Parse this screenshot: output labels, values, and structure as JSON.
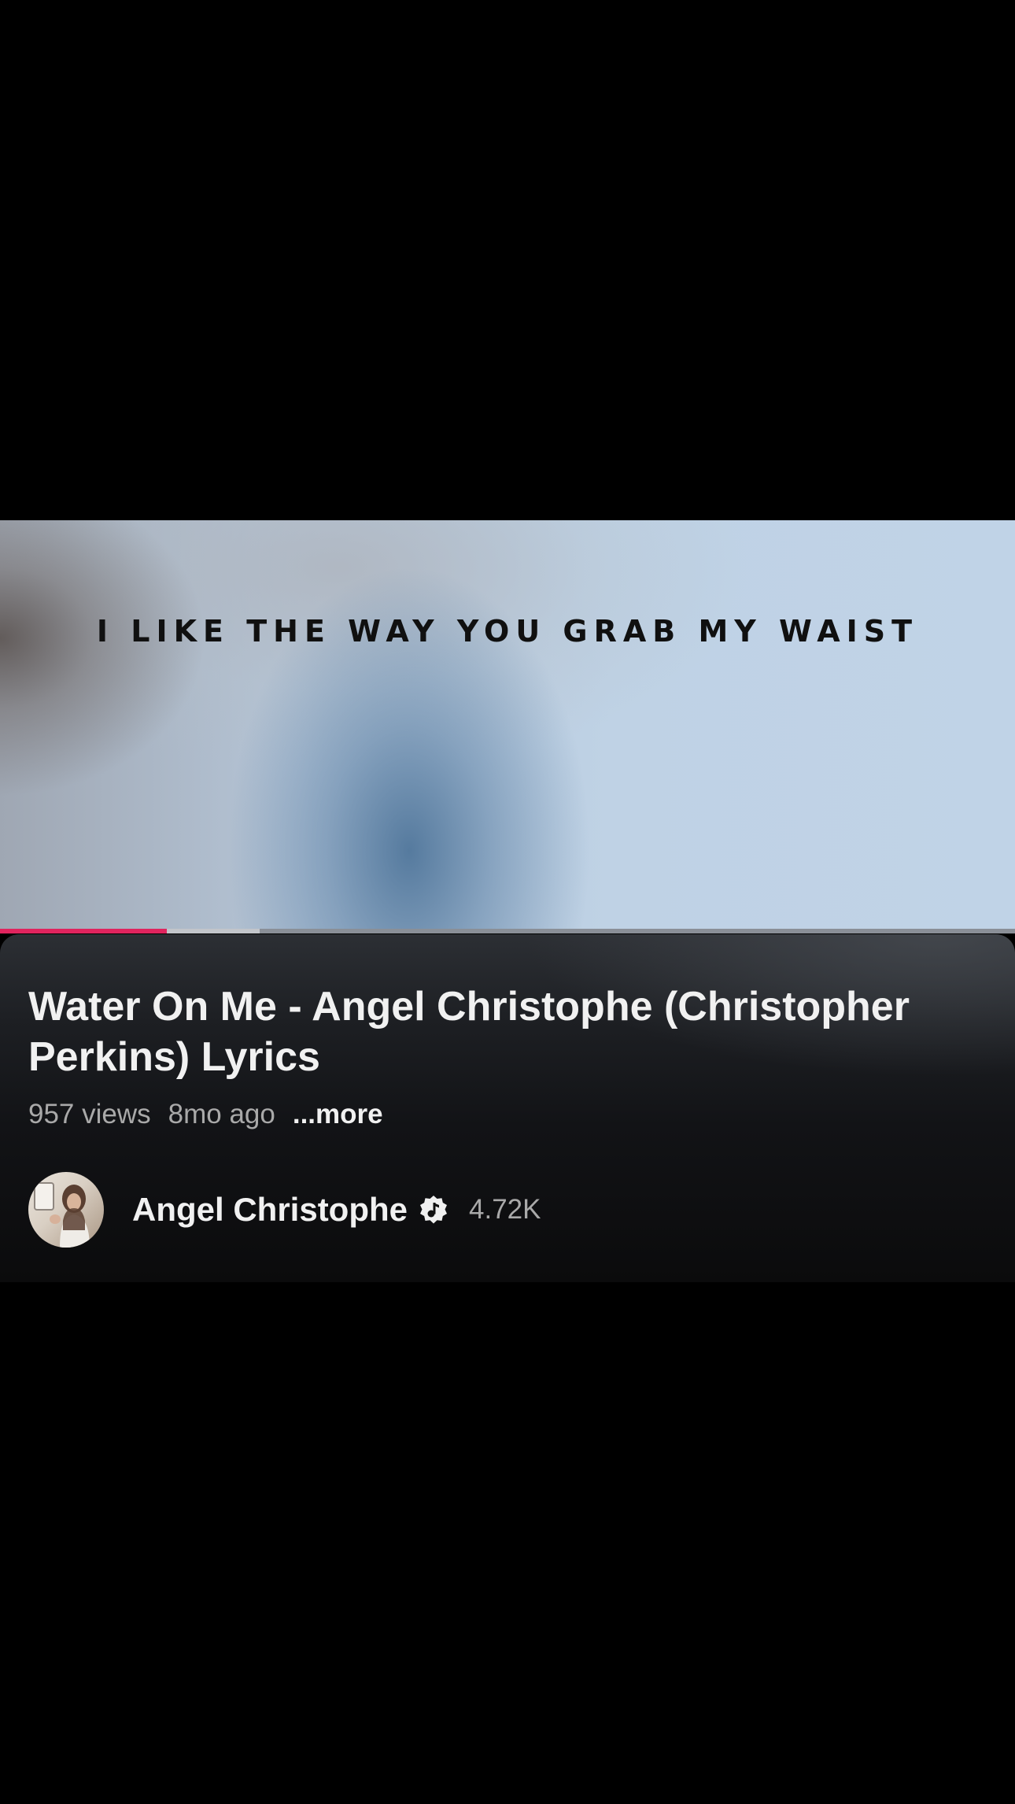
{
  "player": {
    "lyric_text": "I LIKE THE WAY YOU GRAB MY WAIST",
    "progress_played_fraction": 0.164,
    "progress_buffered_fraction": 0.256,
    "progress_color": "#e0245e"
  },
  "video": {
    "title": "Water On Me - Angel Christophe  (Christopher Perkins) Lyrics",
    "views": "957 views",
    "age": "8mo ago",
    "more_label": "...more"
  },
  "channel": {
    "name": "Angel Christophe",
    "verified_icon": "music-note-verified-icon",
    "subscribers": "4.72K"
  }
}
